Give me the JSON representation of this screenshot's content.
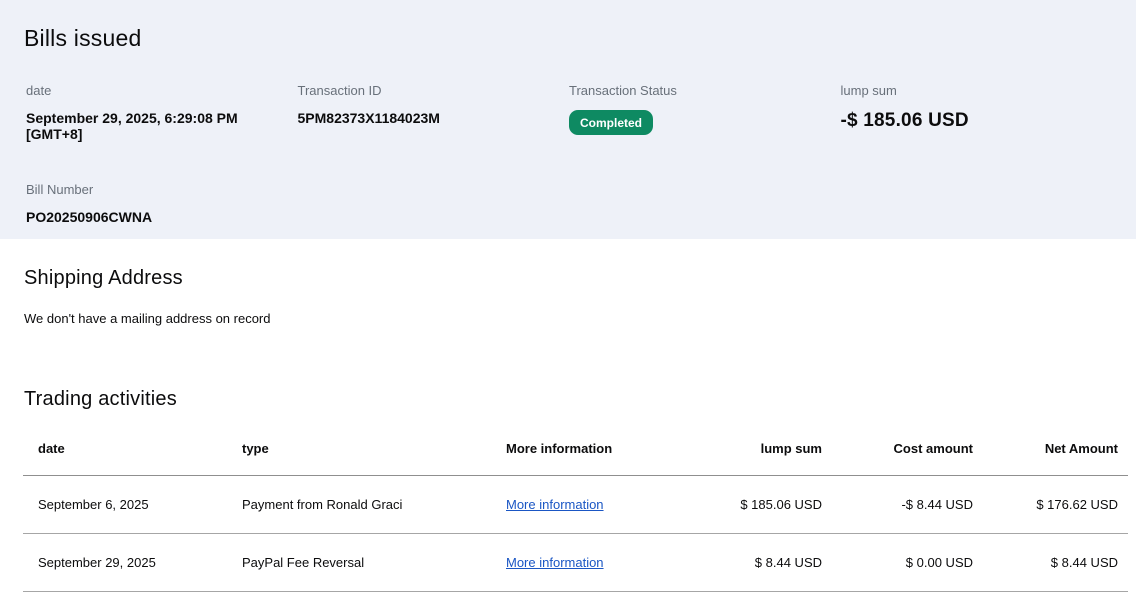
{
  "page": {
    "title": "Bills issued"
  },
  "summary": {
    "date": {
      "label": "date",
      "value": "September 29, 2025, 6:29:08 PM [GMT+8]"
    },
    "transaction_id": {
      "label": "Transaction ID",
      "value": "5PM82373X1184023M"
    },
    "status": {
      "label": "Transaction Status",
      "value": "Completed"
    },
    "lump_sum": {
      "label": "lump sum",
      "value": "-$ 185.06 USD"
    },
    "bill_number": {
      "label": "Bill Number",
      "value": "PO20250906CWNA"
    }
  },
  "shipping": {
    "title": "Shipping Address",
    "message": "We don't have a mailing address on record"
  },
  "trading": {
    "title": "Trading activities",
    "columns": [
      "date",
      "type",
      "More information",
      "lump sum",
      "Cost amount",
      "Net Amount"
    ],
    "rows": [
      {
        "date": "September 6, 2025",
        "type": "Payment from Ronald Graci",
        "more_info": "More information",
        "lump_sum": "$ 185.06 USD",
        "cost_amount": "-$ 8.44 USD",
        "net_amount": "$ 176.62 USD"
      },
      {
        "date": "September 29, 2025",
        "type": "PayPal Fee Reversal",
        "more_info": "More information",
        "lump_sum": "$ 8.44 USD",
        "cost_amount": "$ 0.00 USD",
        "net_amount": "$ 8.44 USD"
      }
    ]
  },
  "colors": {
    "status_green": "#0e8a62",
    "link_blue": "#1a56c4",
    "summary_background": "#eef1f8"
  }
}
